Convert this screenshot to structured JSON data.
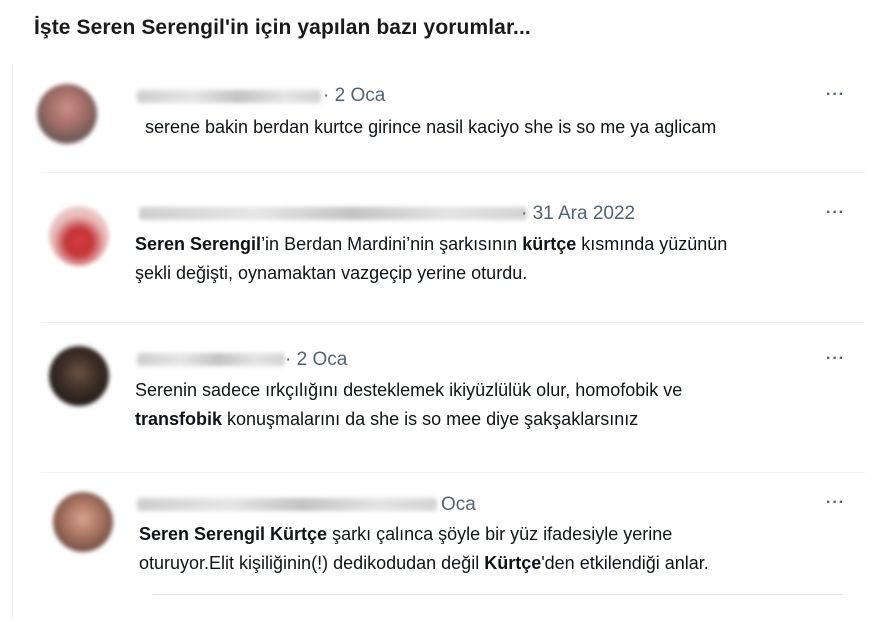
{
  "header": {
    "title": "İşte Seren Serengil'in için yapılan bazı yorumlar..."
  },
  "tweets": [
    {
      "date": "· 2 Oca",
      "more": "···",
      "text": "serene bakin berdan kurtce girince nasil kaciyo she is so me ya aglicam"
    },
    {
      "date": "· 31 Ara 2022",
      "more": "···",
      "text_parts": {
        "b1": "Seren Serengil",
        "t1": "’in Berdan Mardini’nin şarkısının ",
        "b2": "kürtçe",
        "t2": " kısmında yüzünün",
        "line2": "şekli değişti, oynamaktan vazgeçip yerine oturdu."
      }
    },
    {
      "date": "· 2 Oca",
      "more": "···",
      "text_parts": {
        "line1": "Serenin sadece ırkçılığını desteklemek ikiyüzlülük olur, homofobik ve",
        "b1": "transfobik",
        "t1": " konuşmalarını da she is so mee diye şakşaklarsınız"
      }
    },
    {
      "date": "Oca",
      "more": "···",
      "text_parts": {
        "b1": "Seren Serengil Kürtçe",
        "t1": " şarkı çalınca şöyle bir yüz ifadesiyle yerine",
        "line2a": "oturuyor.Elit kişiliğinin(!) dedikodudan değil ",
        "b2": "Kürtçe",
        "line2b": "'den etkilendiği anlar."
      }
    }
  ]
}
